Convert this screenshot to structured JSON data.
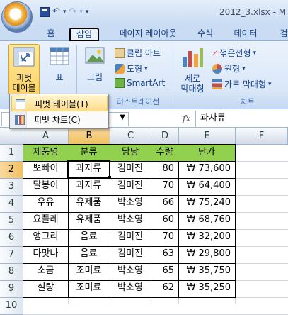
{
  "window": {
    "title": "2012_3.xlsx - M"
  },
  "qat": {
    "save_icon": "save-icon",
    "undo_icon": "undo-icon",
    "redo_icon": "redo-icon",
    "more": "▾"
  },
  "tabs": [
    "홈",
    "삽입",
    "페이지 레이아웃",
    "수식",
    "데이터",
    "검"
  ],
  "active_tab": "삽입",
  "ribbon": {
    "pivot_table_label1": "피벗",
    "pivot_table_label2": "테이블",
    "table_label": "표",
    "picture_label": "그림",
    "clipart_label": "클립 아트",
    "shapes_label": "도형",
    "smartart_label": "SmartArt",
    "illustrations_group": "러스트레이션",
    "column_label1": "세로",
    "column_label2": "막대형",
    "line_label": "꺾은선형",
    "pie_label": "원형",
    "bar_label": "가로 막대형",
    "charts_group": "차트"
  },
  "menu": {
    "items": [
      {
        "label": "피벗 테이블(T)",
        "highlighted": true
      },
      {
        "label": "피벗 차트(C)",
        "highlighted": false
      }
    ]
  },
  "formula_bar": {
    "fx": "fx",
    "value": "과자류"
  },
  "columns": [
    "A",
    "B",
    "C",
    "D",
    "E",
    "F"
  ],
  "selected_column": "B",
  "selected_row": "2",
  "rows": [
    "1",
    "2",
    "3",
    "4",
    "5",
    "6",
    "7",
    "8",
    "9",
    "10"
  ],
  "table": {
    "headers": [
      "제품명",
      "분류",
      "담당",
      "수량",
      "단가"
    ],
    "data": [
      [
        "뽀빠이",
        "과자류",
        "김미진",
        "80",
        "₩ 73,600"
      ],
      [
        "달봉이",
        "과자류",
        "김미진",
        "70",
        "₩ 64,400"
      ],
      [
        "우유",
        "유제품",
        "박소영",
        "66",
        "₩ 75,240"
      ],
      [
        "요플레",
        "유제품",
        "박소영",
        "60",
        "₩ 68,760"
      ],
      [
        "앵그리",
        "음료",
        "김미진",
        "70",
        "₩ 32,200"
      ],
      [
        "다맛나",
        "음료",
        "김미진",
        "63",
        "₩ 29,800"
      ],
      [
        "소금",
        "조미료",
        "박소영",
        "65",
        "₩ 35,750"
      ],
      [
        "설탕",
        "조미료",
        "박소영",
        "62",
        "₩ 35,250"
      ]
    ]
  },
  "colors": {
    "header_fill": "#92d050",
    "accent": "#15428b"
  }
}
